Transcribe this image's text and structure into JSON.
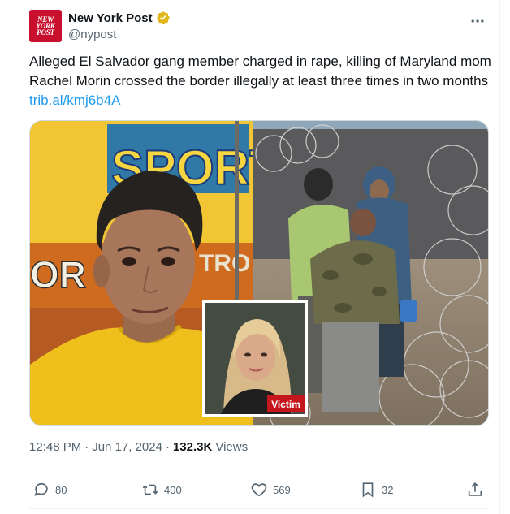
{
  "account": {
    "logo_lines": [
      "NEW",
      "YORK",
      "POST"
    ],
    "display_name": "New York Post",
    "handle": "@nypost",
    "verified_badge": "gold-check-icon"
  },
  "tweet": {
    "text": "Alleged El Salvador gang member charged in rape, killing of Maryland mom Rachel Morin crossed the border illegally at least three times in two months ",
    "link_text": "trib.al/kmj6b4A"
  },
  "media": {
    "left_sign_text": "SPORTS",
    "left_sign_partial": "OR",
    "left_sign_partial2": "TRO",
    "inset_label": "Victim"
  },
  "meta": {
    "time": "12:48 PM",
    "separator": "·",
    "date": "Jun 17, 2024",
    "views_count": "132.3K",
    "views_label": "Views"
  },
  "actions": {
    "replies": "80",
    "reposts": "400",
    "likes": "569",
    "bookmarks": "32"
  },
  "colors": {
    "accent": "#1d9bf0",
    "logo_red": "#c8102e",
    "verified_gold": "#e2b719",
    "victim_red": "#c4161c"
  }
}
